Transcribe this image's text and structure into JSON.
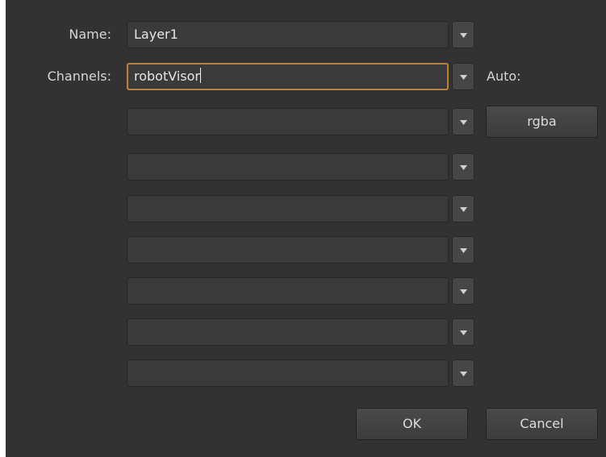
{
  "dialog": {
    "name_label": "Name:",
    "name_value": "Layer1",
    "channels_label": "Channels:",
    "channel_values": [
      "robotVisor",
      "",
      "",
      "",
      "",
      "",
      "",
      ""
    ],
    "auto_label": "Auto:",
    "auto_button": "rgba",
    "ok_button": "OK",
    "cancel_button": "Cancel"
  },
  "colors": {
    "background": "#323232",
    "field": "#3a3a3a",
    "focus_border": "#c5812a",
    "text": "#d8d8d8"
  },
  "icons": {
    "dropdown": "chevron-down-icon"
  }
}
